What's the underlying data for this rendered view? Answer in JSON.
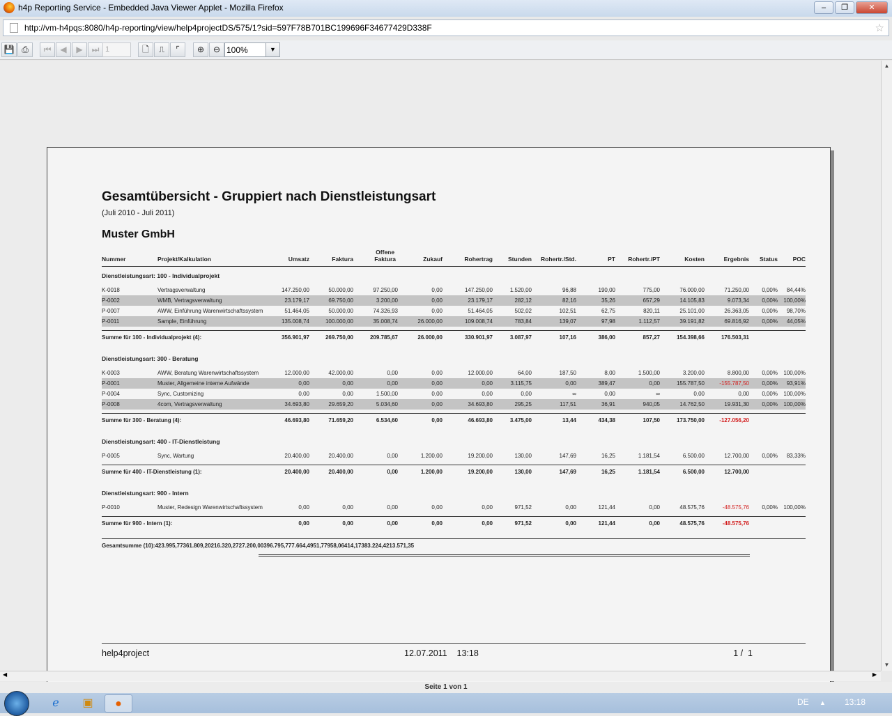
{
  "window": {
    "title": "h4p Reporting Service - Embedded Java Viewer Applet - Mozilla Firefox",
    "url": "http://vm-h4pqs:8080/h4p-reporting/view/help4projectDS/575/1?sid=597F78B701BC199696F34677429D338F"
  },
  "toolbar": {
    "page_value": "1",
    "zoom": "100%"
  },
  "report": {
    "title": "Gesamtübersicht - Gruppiert nach Dienstleistungsart",
    "period": "(Juli 2010 - Juli 2011)",
    "company": "Muster GmbH",
    "columns": [
      "Nummer",
      "Projekt/Kalkulation",
      "Umsatz",
      "Faktura",
      "Offene Faktura",
      "Zukauf",
      "Rohertrag",
      "Stunden",
      "Rohertr./Std.",
      "PT",
      "Rohertr./PT",
      "Kosten",
      "Ergebnis",
      "Status",
      "POC"
    ],
    "groups": [
      {
        "label": "Dienstleistungsart: 100 - Individualprojekt",
        "rows": [
          [
            "K-0018",
            "Vertragsverwaltung",
            "147.250,00",
            "50.000,00",
            "97.250,00",
            "0,00",
            "147.250,00",
            "1.520,00",
            "96,88",
            "190,00",
            "775,00",
            "76.000,00",
            "71.250,00",
            "0,00%",
            "84,44%"
          ],
          [
            "P-0002",
            "WMB, Vertragsverwaltung",
            "23.179,17",
            "69.750,00",
            "3.200,00",
            "0,00",
            "23.179,17",
            "282,12",
            "82,16",
            "35,26",
            "657,29",
            "14.105,83",
            "9.073,34",
            "0,00%",
            "100,00%"
          ],
          [
            "P-0007",
            "AWW, Einführung Warenwirtschaftssystem",
            "51.464,05",
            "50.000,00",
            "74.326,93",
            "0,00",
            "51.464,05",
            "502,02",
            "102,51",
            "62,75",
            "820,11",
            "25.101,00",
            "26.363,05",
            "0,00%",
            "98,70%"
          ],
          [
            "P-0011",
            "Sample, Einführung",
            "135.008,74",
            "100.000,00",
            "35.008,74",
            "26.000,00",
            "109.008,74",
            "783,84",
            "139,07",
            "97,98",
            "1.112,57",
            "39.191,82",
            "69.816,92",
            "0,00%",
            "44,05%"
          ]
        ],
        "sum": [
          "Summe für 100 - Individualprojekt (4):",
          "356.901,97",
          "269.750,00",
          "209.785,67",
          "26.000,00",
          "330.901,97",
          "3.087,97",
          "107,16",
          "386,00",
          "857,27",
          "154.398,66",
          "176.503,31"
        ]
      },
      {
        "label": "Dienstleistungsart: 300 - Beratung",
        "rows": [
          [
            "K-0003",
            "AWW, Beratung Warenwirtschaftssystem",
            "12.000,00",
            "42.000,00",
            "0,00",
            "0,00",
            "12.000,00",
            "64,00",
            "187,50",
            "8,00",
            "1.500,00",
            "3.200,00",
            "8.800,00",
            "0,00%",
            "100,00%"
          ],
          [
            "P-0001",
            "Muster, Allgemeine interne Aufwände",
            "0,00",
            "0,00",
            "0,00",
            "0,00",
            "0,00",
            "3.115,75",
            "0,00",
            "389,47",
            "0,00",
            "155.787,50",
            "-155.787,50",
            "0,00%",
            "93,91%"
          ],
          [
            "P-0004",
            "Sync, Customizing",
            "0,00",
            "0,00",
            "1.500,00",
            "0,00",
            "0,00",
            "0,00",
            "∞",
            "0,00",
            "∞",
            "0,00",
            "0,00",
            "0,00%",
            "100,00%"
          ],
          [
            "P-0008",
            "4com, Vertragsverwaltung",
            "34.693,80",
            "29.659,20",
            "5.034,60",
            "0,00",
            "34.693,80",
            "295,25",
            "117,51",
            "36,91",
            "940,05",
            "14.762,50",
            "19.931,30",
            "0,00%",
            "100,00%"
          ]
        ],
        "sum": [
          "Summe für 300 - Beratung (4):",
          "46.693,80",
          "71.659,20",
          "6.534,60",
          "0,00",
          "46.693,80",
          "3.475,00",
          "13,44",
          "434,38",
          "107,50",
          "173.750,00",
          "-127.056,20"
        ]
      },
      {
        "label": "Dienstleistungsart: 400 - IT-Dienstleistung",
        "rows": [
          [
            "P-0005",
            "Sync, Wartung",
            "20.400,00",
            "20.400,00",
            "0,00",
            "1.200,00",
            "19.200,00",
            "130,00",
            "147,69",
            "16,25",
            "1.181,54",
            "6.500,00",
            "12.700,00",
            "0,00%",
            "83,33%"
          ]
        ],
        "sum": [
          "Summe für 400 - IT-Dienstleistung (1):",
          "20.400,00",
          "20.400,00",
          "0,00",
          "1.200,00",
          "19.200,00",
          "130,00",
          "147,69",
          "16,25",
          "1.181,54",
          "6.500,00",
          "12.700,00"
        ]
      },
      {
        "label": "Dienstleistungsart: 900 - Intern",
        "rows": [
          [
            "P-0010",
            "Muster, Redesign Warenwirtschaftssystem",
            "0,00",
            "0,00",
            "0,00",
            "0,00",
            "0,00",
            "971,52",
            "0,00",
            "121,44",
            "0,00",
            "48.575,76",
            "-48.575,76",
            "0,00%",
            "100,00%"
          ]
        ],
        "sum": [
          "Summe für 900 - Intern (1):",
          "0,00",
          "0,00",
          "0,00",
          "0,00",
          "0,00",
          "971,52",
          "0,00",
          "121,44",
          "0,00",
          "48.575,76",
          "-48.575,76"
        ]
      }
    ],
    "total": [
      "Gesamtsumme (10):",
      "423.995,77",
      "361.809,20",
      "216.320,27",
      "27.200,00",
      "396.795,77",
      "7.664,49",
      "51,77",
      "958,06",
      "414,17",
      "383.224,42",
      "13.571,35"
    ],
    "footer": {
      "left": "help4project",
      "center": "12.07.2011    13:18",
      "right": "1 /  1"
    }
  },
  "statusbar": {
    "text": "Seite 1 von 1"
  },
  "taskbar": {
    "lang": "DE",
    "time": "13:18"
  },
  "colors": {
    "negative": "#d21c1c",
    "shade": "#c4c4c4"
  }
}
